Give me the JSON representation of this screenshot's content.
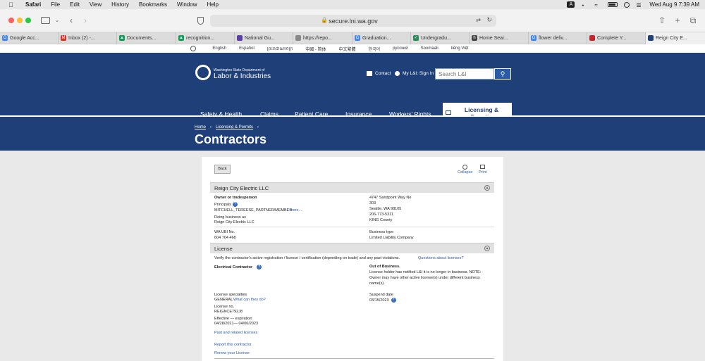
{
  "menubar": {
    "app": "Safari",
    "items": [
      "File",
      "Edit",
      "View",
      "History",
      "Bookmarks",
      "Window",
      "Help"
    ],
    "clock": "Wed Aug 9  7:39 AM",
    "input_source": "A"
  },
  "browser": {
    "url": "secure.lni.wa.gov",
    "tabs": [
      {
        "label": "Google Acc...",
        "icon": "google-icon",
        "color": "#4285f4"
      },
      {
        "label": "Inbox (2) -...",
        "icon": "gmail-icon",
        "color": "#d93025"
      },
      {
        "label": "Documents...",
        "icon": "drive-icon",
        "color": "#0f9d58"
      },
      {
        "label": "recognition...",
        "icon": "drive-icon",
        "color": "#0f9d58"
      },
      {
        "label": "National Gu...",
        "icon": "page-icon",
        "color": "#5b3ea8"
      },
      {
        "label": "https://repo...",
        "icon": "page-icon",
        "color": "#888888"
      },
      {
        "label": "Graduation...",
        "icon": "google-icon",
        "color": "#4285f4"
      },
      {
        "label": "Undergradu...",
        "icon": "check-icon",
        "color": "#2e8b57"
      },
      {
        "label": "Home Sear...",
        "icon": "home-icon",
        "color": "#444444"
      },
      {
        "label": "flower deliv...",
        "icon": "google-icon",
        "color": "#4285f4"
      },
      {
        "label": "Complete Y...",
        "icon": "page-icon",
        "color": "#c0262d"
      },
      {
        "label": "Reign City E...",
        "icon": "page-icon",
        "color": "#1e3f77"
      }
    ]
  },
  "site": {
    "languages": [
      "English",
      "Español",
      "ព្រះរាជាណាចក្រ",
      "中國 - 简体",
      "中文繁體",
      "한국어",
      "русский",
      "Soomaali",
      "tiếng Việt"
    ],
    "logo_small": "Washington State Department of",
    "logo_big": "Labor & Industries",
    "contact_label": "Contact",
    "signin_label": "My L&I: Sign In",
    "search_placeholder": "Search L&I",
    "nav": [
      "Safety & Health",
      "Claims",
      "Patient Care",
      "Insurance",
      "Workers' Rights"
    ],
    "nav_active": "Licensing & Permits",
    "breadcrumbs": [
      "Home",
      "Licensing & Permits"
    ],
    "page_title": "Contractors"
  },
  "record": {
    "back_label": "Back",
    "collapse_label": "Collapse",
    "print_label": "Print",
    "business_name": "Reign City Electric LLC",
    "owner_heading": "Owner or tradesperson",
    "principals_label": "Principals",
    "principals_value": "MITCHELL, TEREESE, PARTNER/MEMBER",
    "more_link": "more...",
    "dba_label": "Doing business as",
    "dba_value": "Reign City Electric LLC",
    "address": [
      "4747 Sandpoint Way Ne",
      "303",
      "Seattle, WA 98105",
      "206-773-5311",
      "KING County"
    ],
    "ubi_label": "WA UBI No.",
    "ubi_value": "604 704 468",
    "btype_label": "Business type",
    "btype_value": "Limited Liability Company",
    "license_section": "License",
    "verify_text": "Verify the contractor's active registration / license / certification (depending on trade) and any past violations.",
    "questions_link": "Questions about licenses?",
    "license_type": "Electrical Contractor",
    "status_heading": "Out of Business.",
    "status_text": [
      "License holder has notified L&I it is no longer in business. NOTE:",
      "Owner may have other active license(s) under different business",
      "name(s)."
    ],
    "specialties_label": "License specialties",
    "specialties_value": "GENERAL",
    "what_link": "What can they do?",
    "suspend_label": "Suspend date",
    "suspend_value": "03/15/2023",
    "license_no_label": "License no.",
    "license_no_value": "REIGNCE792J8",
    "effective_label": "Effective — expiration",
    "effective_value": "04/28/2021— 04/06/2023",
    "past_link": "Past and related licenses",
    "report_link": "Report this contractor",
    "renew_link": "Renew your License"
  }
}
